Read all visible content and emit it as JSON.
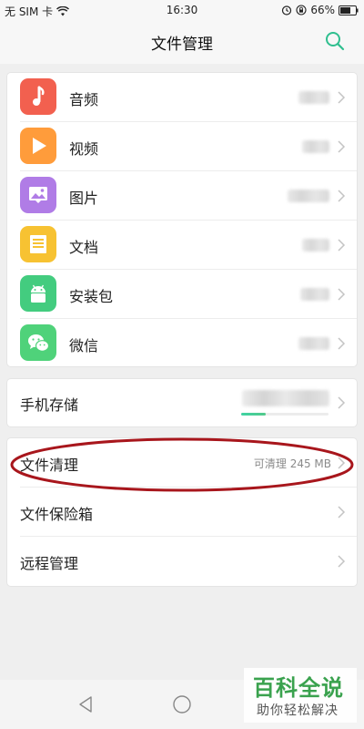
{
  "status_bar": {
    "carrier": "无 SIM 卡",
    "time": "16:30",
    "battery": "66%"
  },
  "header": {
    "title": "文件管理",
    "search_icon": "search-icon"
  },
  "categories": [
    {
      "label": "音频",
      "icon": "music-note-icon",
      "color": "#f2604f"
    },
    {
      "label": "视频",
      "icon": "play-icon",
      "color": "#ff9c3b"
    },
    {
      "label": "图片",
      "icon": "image-icon",
      "color": "#b07ce6"
    },
    {
      "label": "文档",
      "icon": "document-icon",
      "color": "#f7c232"
    },
    {
      "label": "安装包",
      "icon": "android-icon",
      "color": "#43cc7f"
    },
    {
      "label": "微信",
      "icon": "wechat-icon",
      "color": "#4fd27a"
    }
  ],
  "storage": {
    "label": "手机存储",
    "used_fraction": 0.28
  },
  "tools": [
    {
      "label": "文件清理",
      "value": "可清理 245 MB"
    },
    {
      "label": "文件保险箱",
      "value": ""
    },
    {
      "label": "远程管理",
      "value": ""
    }
  ],
  "nav": {
    "back": "back-icon",
    "home": "home-icon"
  },
  "watermark": {
    "title": "百科全说",
    "subtitle": "助你轻松解决"
  },
  "colors": {
    "accent": "#2fbf8f",
    "highlight": "#a8161c"
  }
}
